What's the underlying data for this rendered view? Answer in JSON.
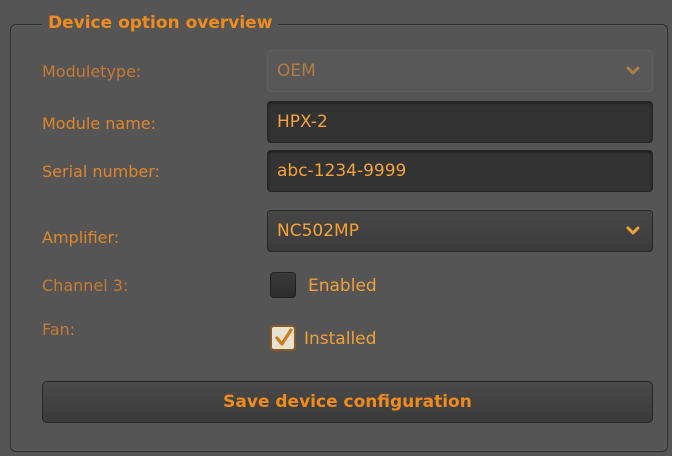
{
  "group": {
    "title": "Device option overview"
  },
  "fields": {
    "moduletype": {
      "label": "Moduletype:",
      "value": "OEM"
    },
    "module_name": {
      "label": "Module name:",
      "value": "HPX-2"
    },
    "serial_number": {
      "label": "Serial number:",
      "value": "abc-1234-9999"
    },
    "amplifier": {
      "label": "Amplifier:",
      "value": "NC502MP"
    },
    "channel3": {
      "label": "Channel 3:",
      "checkbox_label": "Enabled",
      "checked": false
    },
    "fan": {
      "label": "Fan:",
      "checkbox_label": "Installed",
      "checked": true
    }
  },
  "actions": {
    "save_label": "Save device configuration"
  },
  "colors": {
    "accent": "#f08c1e",
    "panel_bg": "#555555",
    "field_bg": "#333333"
  },
  "icons": {
    "dropdown": "chevron-down-icon",
    "check": "checkmark-icon"
  }
}
